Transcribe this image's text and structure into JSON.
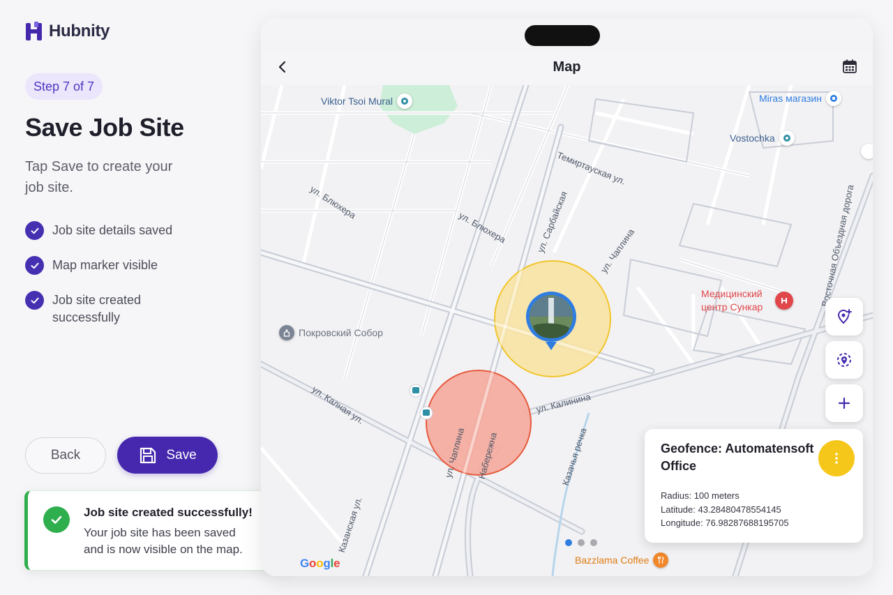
{
  "brand": {
    "name": "Hubnity",
    "color": "#4529ac"
  },
  "step": {
    "label": "Step 7 of 7"
  },
  "page": {
    "title": "Save Job Site",
    "subtitle": "Tap Save to create your job site."
  },
  "checklist": [
    {
      "label": "Job site details saved",
      "done": true
    },
    {
      "label": "Map marker visible",
      "done": true
    },
    {
      "label": "Job site created successfully",
      "done": true
    }
  ],
  "actions": {
    "back_label": "Back",
    "save_label": "Save"
  },
  "toast": {
    "title": "Job site created successfully!",
    "body": "Your job site has been saved and is now visible on the map.",
    "status_color": "#2fae4d"
  },
  "device": {
    "title": "Map",
    "icons": {
      "back": "chevron-left-icon",
      "calendar": "calendar-icon"
    }
  },
  "map": {
    "road_labels": [
      "ул. Блюхера",
      "ул. Блюхера",
      "Темиртауская ул.",
      "ул. Сарбайская",
      "ул. Чаплина",
      "ул. Калная ул.",
      "ул. Калинина",
      "ул. Чаплина",
      "Набережна",
      "Казачья речка",
      "Казанская ул.",
      "Восточная Объездная дорога"
    ],
    "pois": [
      {
        "name": "Viktor Tsoi Mural",
        "color": "#3b5f8f"
      },
      {
        "name": "Miras магазин",
        "color": "#2f7de1"
      },
      {
        "name": "Vostochka",
        "color": "#3b5f8f"
      },
      {
        "name": "Медицинский центр Сункар",
        "color": "#e0464a"
      },
      {
        "name": "Покровский Собор",
        "color": "#6b7280"
      },
      {
        "name": "Bazzlama Coffee",
        "color": "#e07b12"
      }
    ],
    "attribution": "Google",
    "pages": {
      "count": 3,
      "active": 1
    },
    "controls": [
      "add-location-icon",
      "geofence-icon",
      "plus-icon"
    ]
  },
  "geofence": {
    "title": "Geofence: Automatensoft Office",
    "radius": "Radius: 100 meters",
    "latitude": "Latitude: 43.28480478554145",
    "longitude": "Longitude: 76.98287688195705",
    "accent": "#f6c71b"
  },
  "colors": {
    "primary": "#4528ad",
    "geofence_yellow_fill": "#f8e3a4",
    "geofence_yellow_stroke": "#f1c52b",
    "geofence_red_fill": "#f5aa9c",
    "geofence_red_stroke": "#e65a3e"
  }
}
